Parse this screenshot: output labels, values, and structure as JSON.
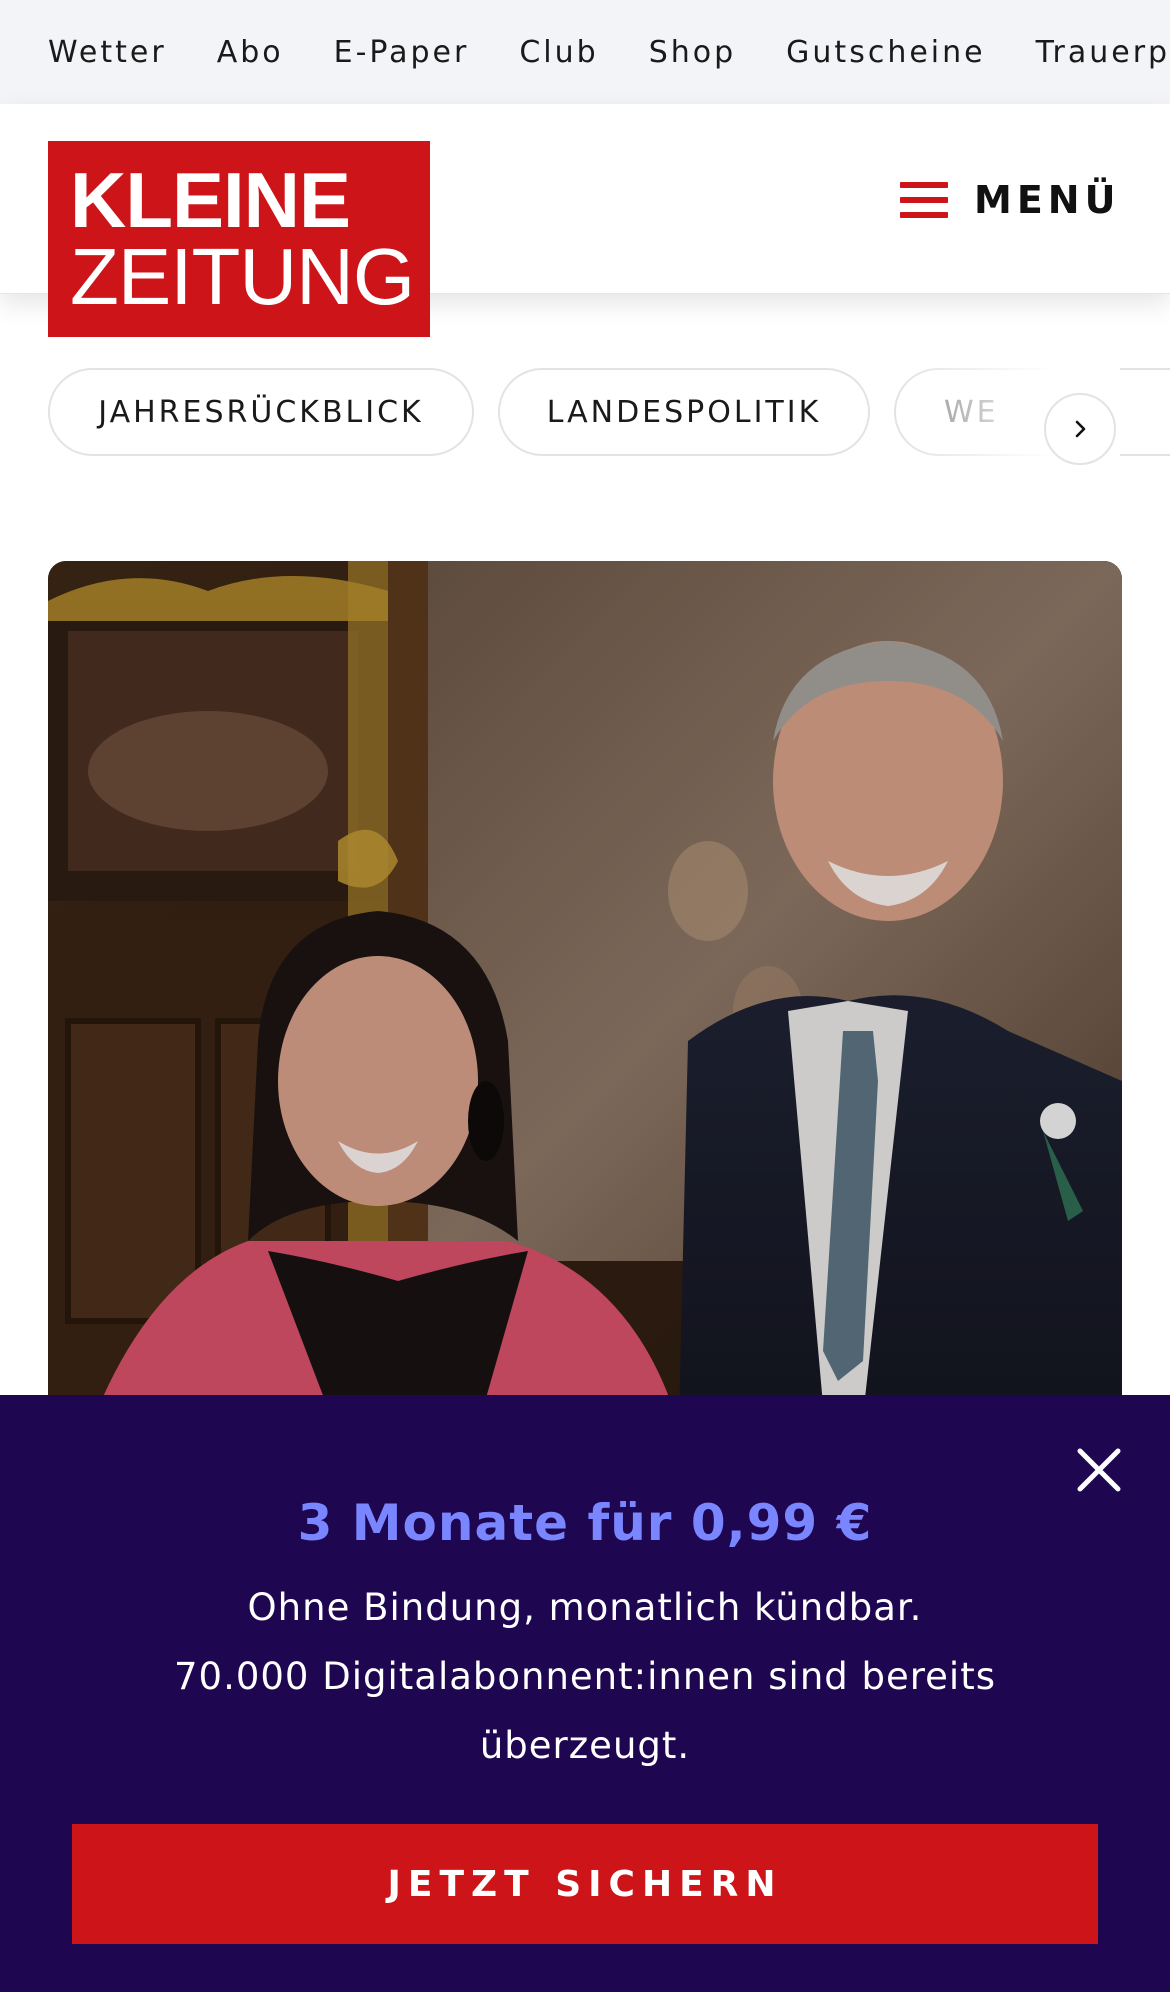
{
  "topnav": {
    "items": [
      {
        "label": "Wetter"
      },
      {
        "label": "Abo"
      },
      {
        "label": "E-Paper"
      },
      {
        "label": "Club"
      },
      {
        "label": "Shop"
      },
      {
        "label": "Gutscheine"
      },
      {
        "label": "Trauerpo"
      }
    ]
  },
  "header": {
    "logo_line1": "KLEINE",
    "logo_line2": "ZEITUNG",
    "menu_label": "MENÜ",
    "menu_icon": "hamburger-icon"
  },
  "chips": {
    "items": [
      {
        "label": "JAHRESRÜCKBLICK"
      },
      {
        "label": "LANDESPOLITIK"
      },
      {
        "label": "WE"
      }
    ],
    "next_icon": "chevron-right-icon"
  },
  "hero": {
    "image": "photo-man-and-woman-in-ornate-hall"
  },
  "offer": {
    "title": "3 Monate für 0,99 €",
    "line1": "Ohne Bindung, monatlich kündbar.",
    "line2": "70.000 Digitalabonnent:innen sind bereits überzeugt.",
    "cta_label": "JETZT SICHERN",
    "close_icon": "close-icon"
  },
  "colors": {
    "brand_red": "#cc1419",
    "offer_bg": "#1e0651",
    "offer_title": "#7a86ff",
    "topnav_bg": "#f3f4f7"
  }
}
